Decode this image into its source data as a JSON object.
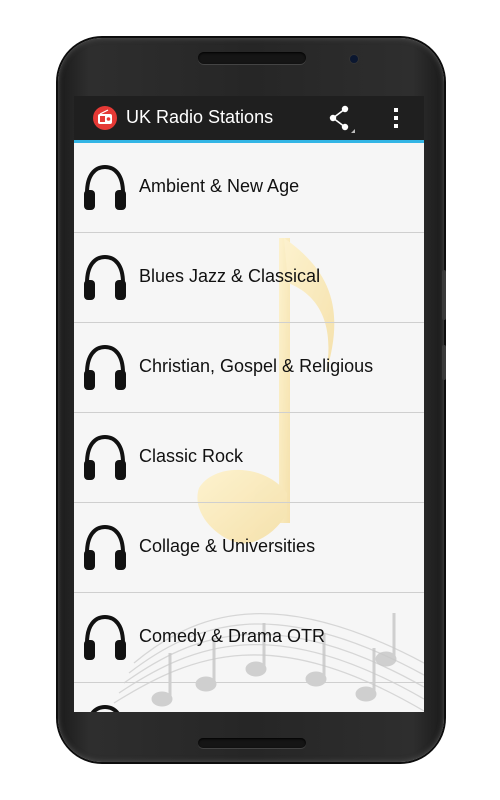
{
  "app": {
    "title": "UK Radio Stations",
    "icon": "radio-icon",
    "accent_color": "#33b5e5",
    "actionbar_color": "#1f1f1f"
  },
  "actions": {
    "share_icon": "share-icon",
    "overflow_icon": "overflow-menu-icon"
  },
  "categories": [
    {
      "label": "Ambient & New Age",
      "icon": "headphones-icon"
    },
    {
      "label": "Blues Jazz & Classical",
      "icon": "headphones-icon"
    },
    {
      "label": "Christian, Gospel & Religious",
      "icon": "headphones-icon"
    },
    {
      "label": "Classic Rock",
      "icon": "headphones-icon"
    },
    {
      "label": "Collage & Universities",
      "icon": "headphones-icon"
    },
    {
      "label": "Comedy & Drama OTR",
      "icon": "headphones-icon"
    },
    {
      "label": "",
      "icon": "headphones-icon"
    }
  ]
}
